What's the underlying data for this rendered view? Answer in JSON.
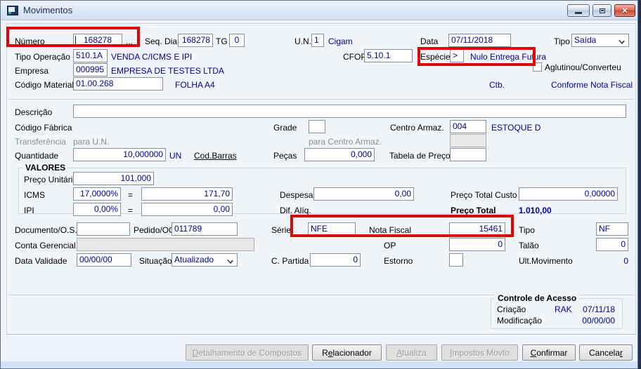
{
  "window": {
    "title": "Movimentos"
  },
  "accent": {
    "field_text": "#0000a0",
    "highlight": "#dd0505"
  },
  "row1": {
    "numero_label": "Número",
    "numero_value": "168278",
    "ellipsis": "...",
    "seq_dia_label": "Seq. Dia",
    "seq_dia_value": "168278",
    "tg_label": "TG",
    "tg_value": "0",
    "un_label": "U.N.",
    "un_value": "1",
    "un_name": "Cigam",
    "data_label": "Data",
    "data_value": "07/11/2018",
    "tipo_label": "Tipo",
    "tipo_value": "Saída"
  },
  "row2": {
    "tipo_operacao_label": "Tipo Operação",
    "tipo_operacao_code": "510.1A",
    "tipo_operacao_desc": "VENDA C/ICMS E IPI",
    "cfop_label": "CFOP",
    "cfop_value": "5.10.1",
    "especie_label": "Espécie",
    "especie_selector": ">",
    "especie_value": "Nulo Entrega Futura",
    "aglutinou_label": "Aglutinou/Converteu"
  },
  "row3": {
    "empresa_label": "Empresa",
    "empresa_code": "000995",
    "empresa_desc": "EMPRESA DE TESTES LTDA"
  },
  "row4": {
    "codigo_material_label": "Código Material",
    "codigo_material_value": "01.00.268",
    "codigo_material_desc": "FOLHA A4",
    "ctb_label": "Ctb.",
    "conforme_label": "Conforme Nota Fiscal"
  },
  "detail": {
    "descricao_label": "Descrição",
    "descricao_value": "",
    "codigo_fabrica_label": "Código Fábrica",
    "grade_label": "Grade",
    "grade_value": "",
    "centro_armaz_label": "Centro Armaz.",
    "centro_armaz_value": "004",
    "centro_armaz_desc": "ESTOQUE D",
    "transferencia_label": "Transferência",
    "para_un_label": "para U.N.",
    "para_centro_label": "para Centro Armaz.",
    "para_centro_value": "",
    "quantidade_label": "Quantidade",
    "quantidade_value": "10,000000",
    "quantidade_um": "UN",
    "cod_barras_label": "Cod.Barras",
    "pecas_label": "Peças",
    "pecas_value": "0,000",
    "tabela_preco_label": "Tabela de Preço",
    "tabela_preco_value": ""
  },
  "valores": {
    "title": "VALORES",
    "preco_unitario_label": "Preço Unitário",
    "preco_unitario_value": "101,000",
    "equals": "=",
    "icms_label": "ICMS",
    "icms_pct": "17,0000%",
    "icms_value": "171,70",
    "ipi_label": "IPI",
    "ipi_pct": "0,00%",
    "ipi_value": "0,00",
    "despesas_label": "Despesas",
    "despesas_value": "0,00",
    "dif_aliq_label": "Dif. Alíq.",
    "preco_total_custo_label": "Preço Total Custo",
    "preco_total_custo_value": "0,00000",
    "preco_total_label": "Preço Total",
    "preco_total_value": "1.010,00"
  },
  "doc": {
    "documento_label": "Documento/O.S.",
    "documento_value": "",
    "pedido_label": "Pedido/OC",
    "pedido_value": "011789",
    "serie_label": "Série",
    "serie_value": "NFE",
    "nota_fiscal_label": "Nota Fiscal",
    "nota_fiscal_value": "15461",
    "tipo_label": "Tipo",
    "tipo_value": "NF",
    "conta_gerencial_label": "Conta Gerencial",
    "conta_gerencial_value": "",
    "op_label": "OP",
    "op_value": "0",
    "talao_label": "Talão",
    "talao_value": "0",
    "data_validade_label": "Data Validade",
    "data_validade_value": "00/00/00",
    "situacao_label": "Situação",
    "situacao_value": "Atualizado",
    "c_partida_label": "C. Partida",
    "c_partida_value": "0",
    "estorno_label": "Estorno",
    "estorno_value": "",
    "ult_movimento_label": "Ult.Movimento",
    "ult_movimento_value": "0"
  },
  "acesso": {
    "title": "Controle de Acesso",
    "criacao_label": "Criação",
    "criacao_user": "RAK",
    "criacao_date": "07/11/18",
    "modificacao_label": "Modificação",
    "modificacao_date": "00/00/00"
  },
  "buttons": [
    {
      "pre": "",
      "u": "D",
      "post": "etalhamento de Compostos",
      "disabled": true
    },
    {
      "pre": "R",
      "u": "e",
      "post": "lacionador",
      "disabled": false
    },
    {
      "pre": "",
      "u": "A",
      "post": "tualiza",
      "disabled": true
    },
    {
      "pre": "",
      "u": "I",
      "post": "mpostos Movto",
      "disabled": true
    },
    {
      "pre": "",
      "u": "C",
      "post": "onfirmar",
      "disabled": false
    },
    {
      "pre": "Cancela",
      "u": "r",
      "post": "",
      "disabled": false
    }
  ]
}
